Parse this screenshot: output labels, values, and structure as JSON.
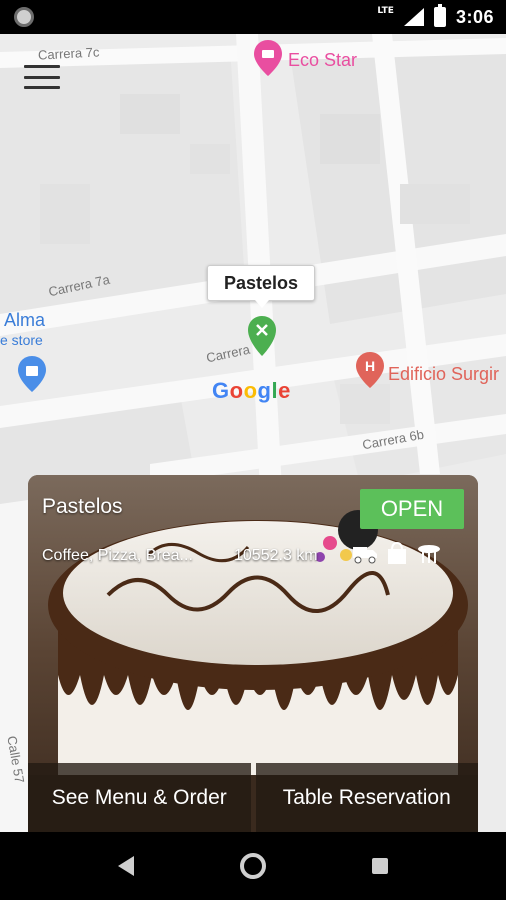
{
  "status_bar": {
    "network": "LTE",
    "time": "3:06"
  },
  "map": {
    "streets": {
      "carrera_7c": "Carrera 7c",
      "carrera_7a": "Carrera 7a",
      "carrera": "Carrera",
      "carrera_6b": "Carrera 6b",
      "calle_57": "Calle 57"
    },
    "pois": {
      "eco_star": "Eco Star",
      "alma": "Alma",
      "alma_sub": "e store",
      "edificio": "Edificio Surgir"
    },
    "marker_label": "Pastelos",
    "attribution": "Google"
  },
  "card": {
    "name": "Pastelos",
    "status": "OPEN",
    "categories": "Coffee, Pizza, Brea...",
    "distance": "10552.3 km",
    "actions": {
      "menu": "See Menu & Order",
      "reservation": "Table Reservation"
    }
  },
  "colors": {
    "open_green": "#5cc05a",
    "marker_green": "#4caf50",
    "poi_pink": "#e94ea0"
  }
}
